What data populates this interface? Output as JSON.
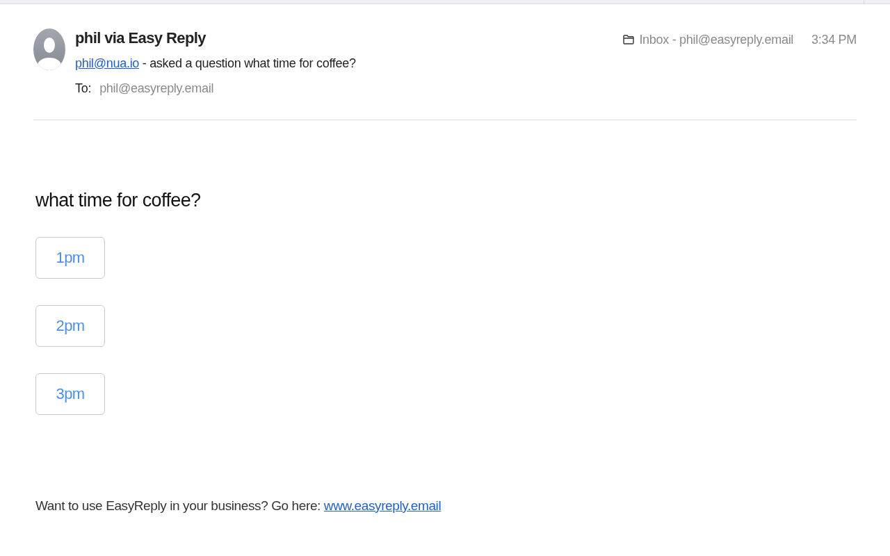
{
  "message": {
    "sender_name": "phil via Easy Reply",
    "sender_email": "phil@nua.io",
    "summary": "- asked a question what time for coffee?",
    "to_label": "To:",
    "to_address": "phil@easyreply.email",
    "folder": "Inbox - phil@easyreply.email",
    "time": "3:34 PM"
  },
  "body": {
    "question": "what time for coffee?",
    "options": [
      "1pm",
      "2pm",
      "3pm"
    ],
    "footer_text": "Want to use EasyReply in your business? Go here:",
    "footer_link": "www.easyreply.email"
  }
}
